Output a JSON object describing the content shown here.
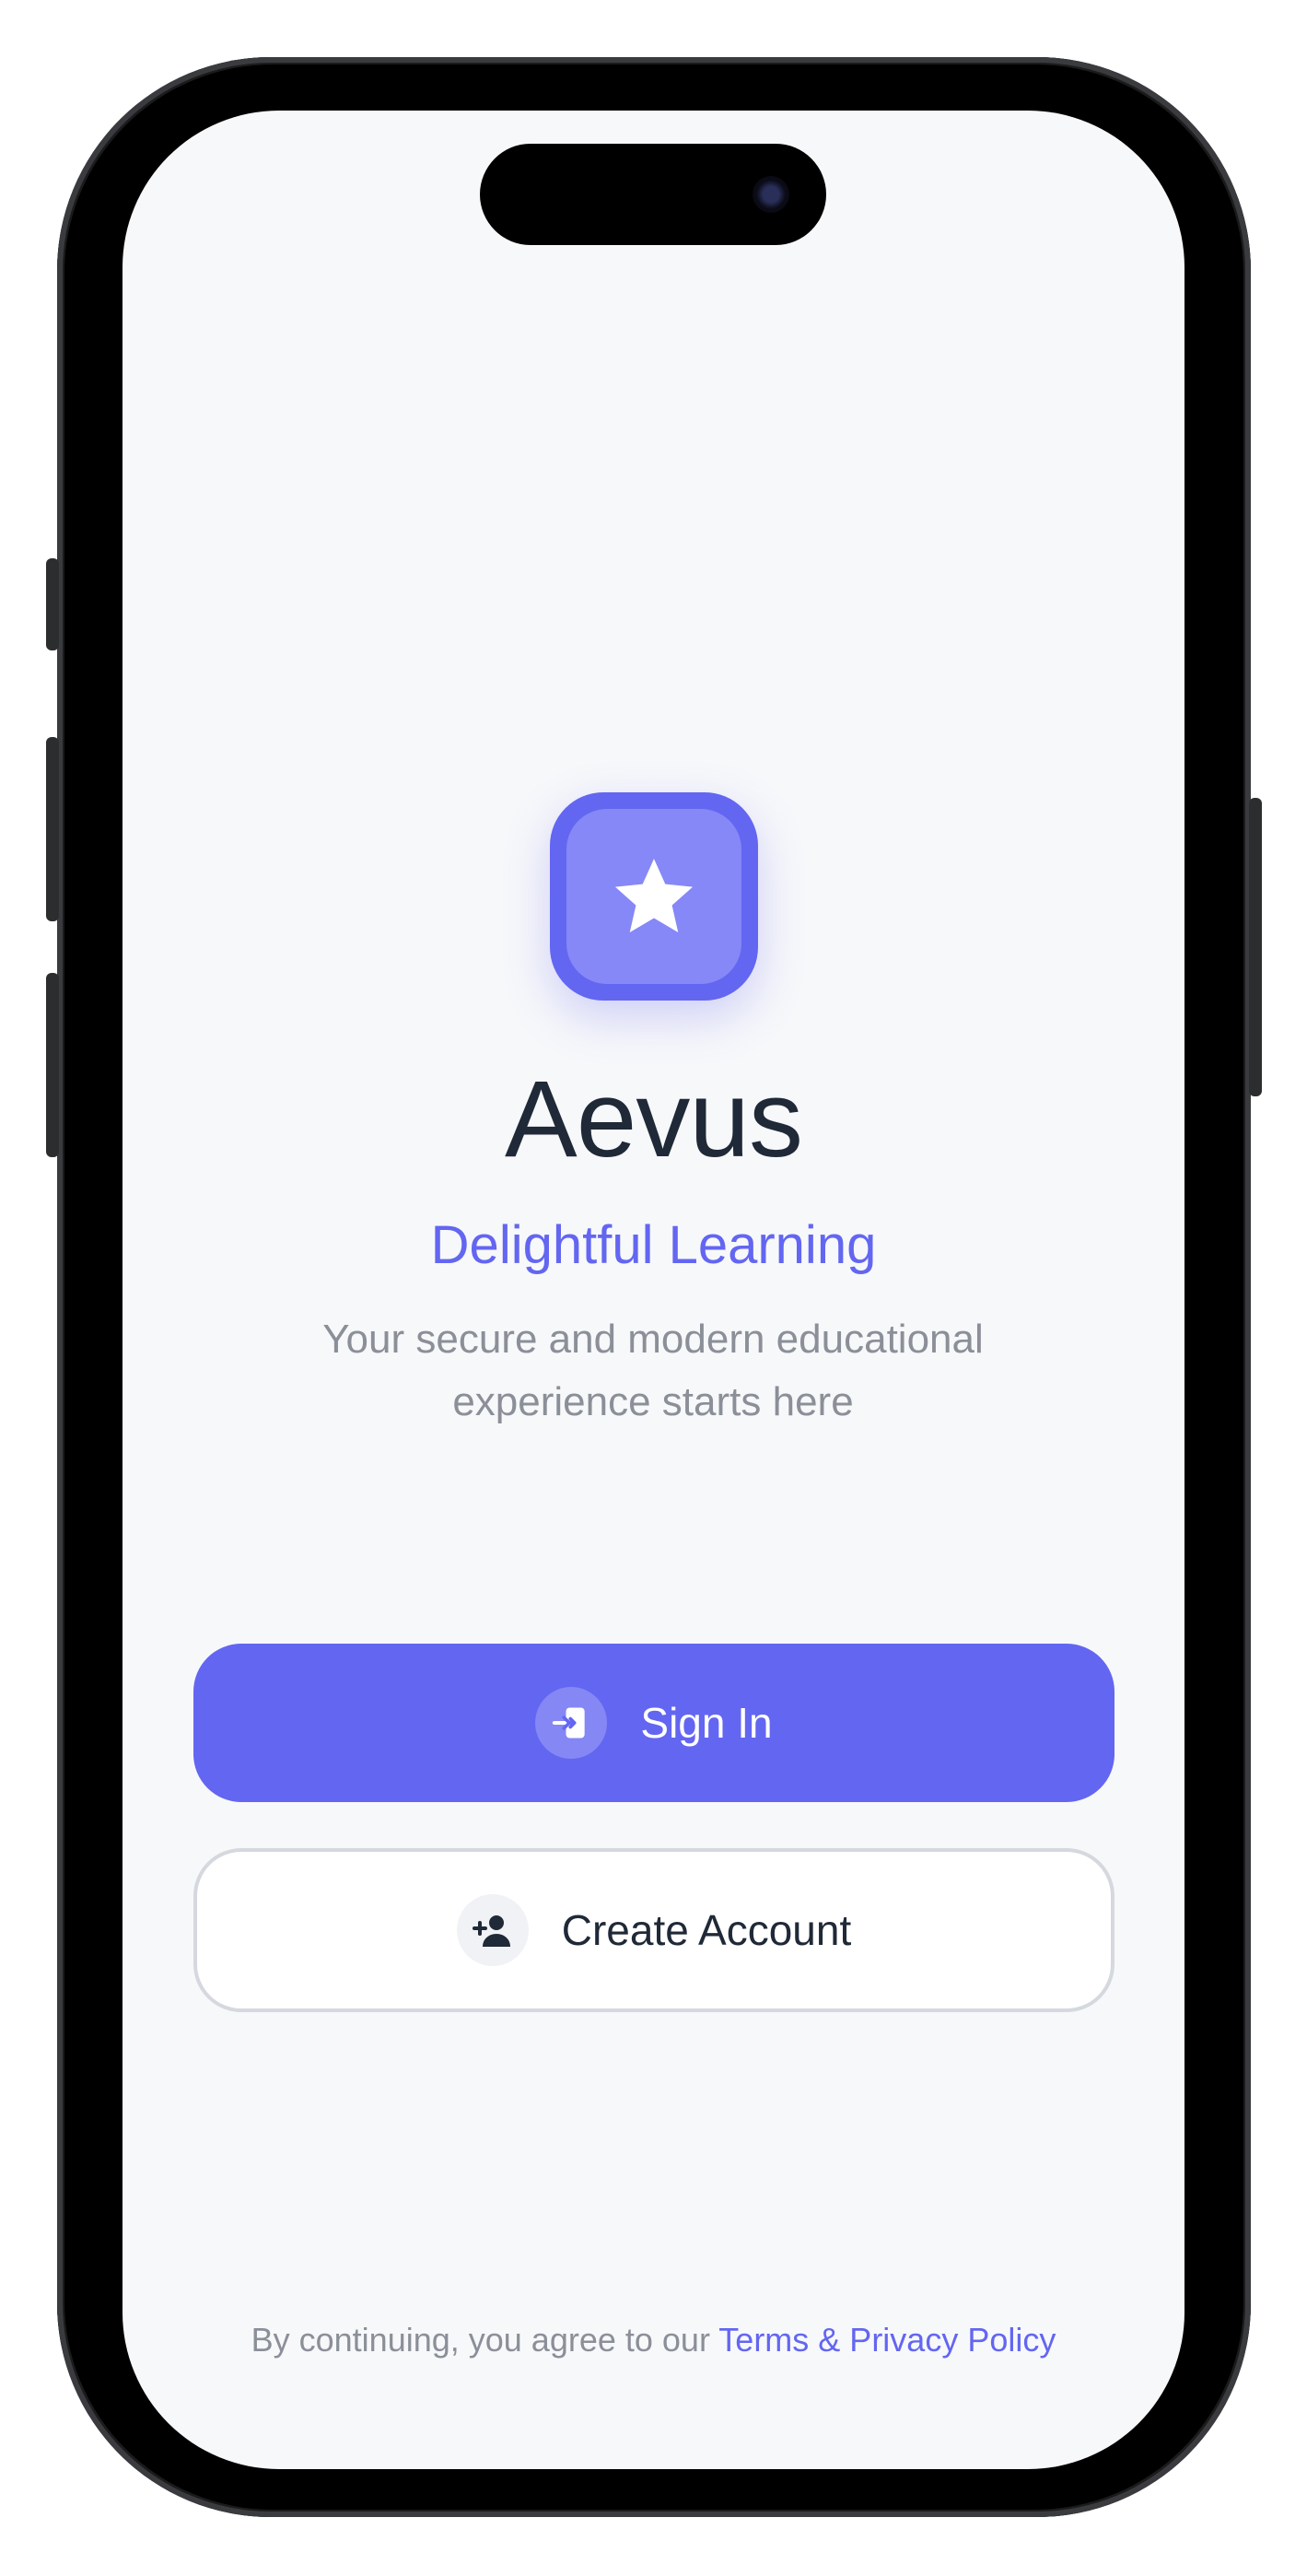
{
  "brand": {
    "name": "Aevus",
    "tagline": "Delightful Learning",
    "description": "Your secure and modern educational experience starts here",
    "logo_icon": "star-icon",
    "accent_color": "#6366f1"
  },
  "actions": {
    "sign_in": {
      "label": "Sign In",
      "icon": "sign-in-icon"
    },
    "create_account": {
      "label": "Create Account",
      "icon": "add-user-icon"
    }
  },
  "footer": {
    "text": "By continuing, you agree to our",
    "link_label": "Terms & Privacy Policy"
  }
}
